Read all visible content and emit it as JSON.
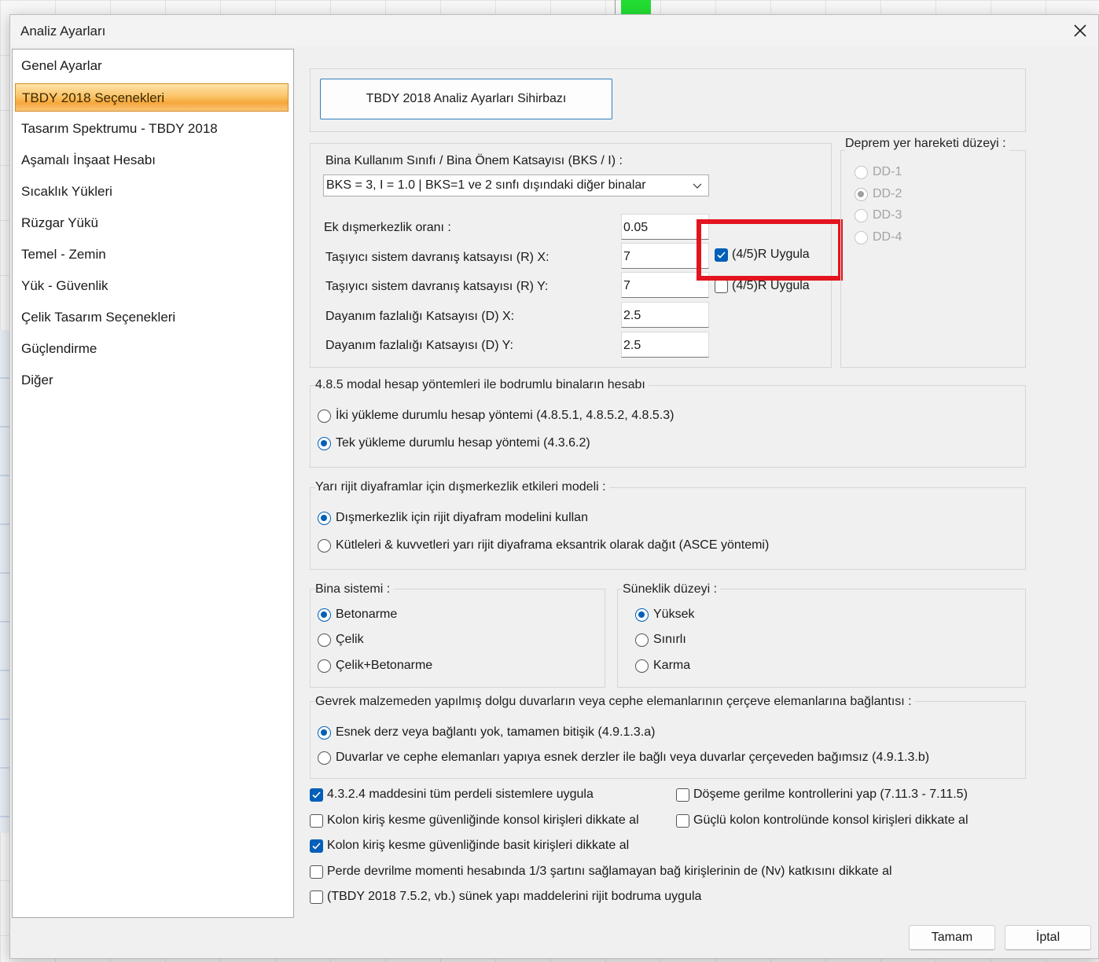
{
  "window": {
    "title": "Analiz Ayarları"
  },
  "sidebar": {
    "items": [
      {
        "label": "Genel Ayarlar"
      },
      {
        "label": "TBDY 2018 Seçenekleri"
      },
      {
        "label": "Tasarım Spektrumu - TBDY 2018"
      },
      {
        "label": "Aşamalı İnşaat Hesabı"
      },
      {
        "label": "Sıcaklık Yükleri"
      },
      {
        "label": "Rüzgar Yükü"
      },
      {
        "label": "Temel - Zemin"
      },
      {
        "label": "Yük - Güvenlik"
      },
      {
        "label": "Çelik Tasarım Seçenekleri"
      },
      {
        "label": "Güçlendirme"
      },
      {
        "label": "Diğer"
      }
    ],
    "selected": "TBDY 2018 Seçenekleri"
  },
  "wizard": {
    "label": "TBDY 2018 Analiz Ayarları Sihirbazı"
  },
  "building": {
    "bks_label": "Bina Kullanım Sınıfı / Bina Önem Katsayısı (BKS / I) :",
    "bks_value": "BKS = 3, I = 1.0 | BKS=1 ve 2 sınfı dışındaki diğer binalar",
    "eccentricity_label": "Ek dışmerkezlik oranı :",
    "eccentricity_value": "0.05",
    "rx_label": "Taşıyıcı sistem davranış katsayısı (R) X:",
    "rx_value": "7",
    "ry_label": "Taşıyıcı sistem davranış katsayısı (R) Y:",
    "ry_value": "7",
    "dx_label": "Dayanım fazlalığı Katsayısı (D) X:",
    "dx_value": "2.5",
    "dy_label": "Dayanım fazlalığı Katsayısı (D) Y:",
    "dy_value": "2.5",
    "apply45r_x_label": "(4/5)R Uygula",
    "apply45r_x_checked": true,
    "apply45r_y_label": "(4/5)R Uygula",
    "apply45r_y_checked": false
  },
  "earthquake_level": {
    "legend": "Deprem yer hareketi düzeyi :",
    "options": [
      "DD-1",
      "DD-2",
      "DD-3",
      "DD-4"
    ],
    "selected": "DD-2",
    "enabled": false
  },
  "modal": {
    "legend": "4.8.5 modal hesap yöntemleri ile bodrumlu binaların hesabı",
    "options": [
      "İki yükleme durumlu hesap yöntemi (4.8.5.1, 4.8.5.2, 4.8.5.3)",
      "Tek yükleme durumlu hesap yöntemi (4.3.6.2)"
    ],
    "selected": 1
  },
  "diaphragm": {
    "legend": "Yarı rijit diyaframlar için dışmerkezlik etkileri modeli :",
    "options": [
      "Dışmerkezlik için rijit diyafram modelini kullan",
      "Kütleleri & kuvvetleri yarı rijit diyaframa eksantrik olarak dağıt (ASCE yöntemi)"
    ],
    "selected": 0
  },
  "system": {
    "legend": "Bina sistemi :",
    "options": [
      "Betonarme",
      "Çelik",
      "Çelik+Betonarme"
    ],
    "selected": 0
  },
  "ductility": {
    "legend": "Süneklik düzeyi :",
    "options": [
      "Yüksek",
      "Sınırlı",
      "Karma"
    ],
    "selected": 0
  },
  "infill": {
    "legend": "Gevrek malzemeden yapılmış dolgu duvarların veya cephe elemanlarının çerçeve elemanlarına bağlantısı :",
    "options": [
      "Esnek derz veya bağlantı yok, tamamen bitişik (4.9.1.3.a)",
      "Duvarlar ve cephe elemanları yapıya esnek derzler ile bağlı veya duvarlar çerçeveden bağımsız (4.9.1.3.b)"
    ],
    "selected": 0
  },
  "checks": {
    "c1": {
      "label": "4.3.2.4 maddesini tüm perdeli sistemlere uygula",
      "checked": true
    },
    "c2": {
      "label": "Döşeme gerilme kontrollerini yap (7.11.3 - 7.11.5)",
      "checked": false
    },
    "c3": {
      "label": "Kolon kiriş kesme güvenliğinde konsol kirişleri dikkate al",
      "checked": false
    },
    "c4": {
      "label": "Güçlü kolon kontrolünde konsol kirişleri dikkate al",
      "checked": false
    },
    "c5": {
      "label": "Kolon kiriş kesme güvenliğinde basit kirişleri dikkate al",
      "checked": true
    },
    "c6": {
      "label": "Perde devrilme momenti hesabında 1/3 şartını sağlamayan bağ kirişlerinin de (Nv) katkısını dikkate al",
      "checked": false
    },
    "c7": {
      "label": "(TBDY 2018 7.5.2, vb.) sünek yapı maddelerini rijit bodruma uygula",
      "checked": false
    }
  },
  "footer": {
    "ok_label": "Tamam",
    "cancel_label": "İptal"
  },
  "colors": {
    "accent": "#005fb8",
    "highlight": "#e3141f",
    "selected_item": "#f6a73b"
  }
}
